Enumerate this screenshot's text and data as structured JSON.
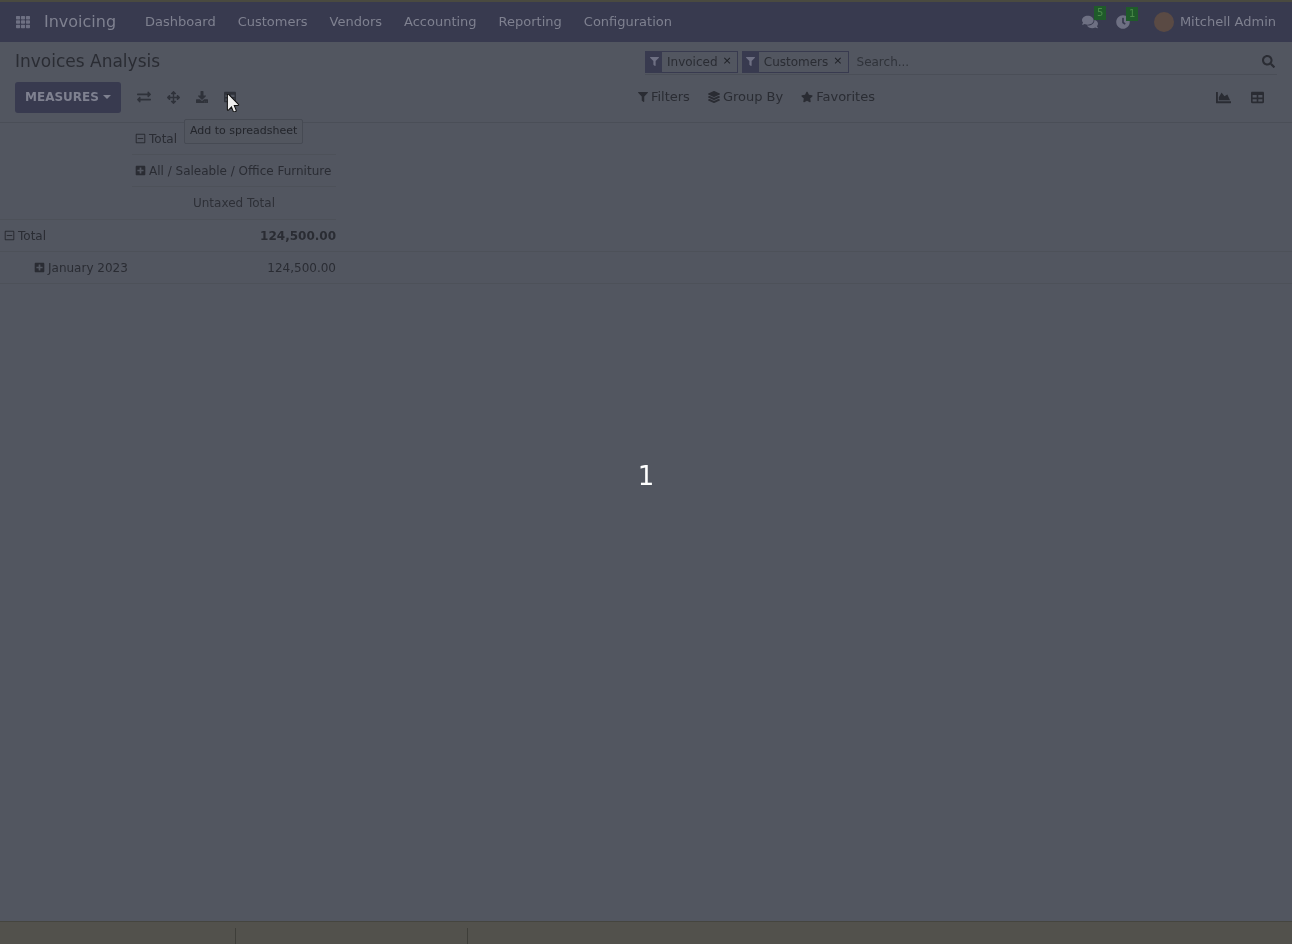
{
  "navbar": {
    "app_name": "Invoicing",
    "menu": [
      "Dashboard",
      "Customers",
      "Vendors",
      "Accounting",
      "Reporting",
      "Configuration"
    ],
    "messages_badge": "5",
    "activities_badge": "1",
    "user": "Mitchell Admin"
  },
  "breadcrumb": "Invoices Analysis",
  "search": {
    "facets": [
      {
        "label": "Invoiced",
        "remove": "×"
      },
      {
        "label": "Customers",
        "remove": "×"
      }
    ],
    "placeholder": "Search..."
  },
  "measures_button": "MEASURES",
  "search_menus": [
    {
      "kind": "filter",
      "label": "Filters"
    },
    {
      "kind": "group",
      "label": "Group By"
    },
    {
      "kind": "favorite",
      "label": "Favorites"
    }
  ],
  "views": [
    {
      "kind": "graph"
    },
    {
      "kind": "pivot"
    }
  ],
  "tooltip": "Add to spreadsheet",
  "pivot": {
    "col_headers": [
      {
        "label": "Total",
        "expanded": true
      },
      {
        "label": "All / Saleable / Office Furniture",
        "expanded": false
      }
    ],
    "measure": "Untaxed Total",
    "rows": [
      {
        "label": "Total",
        "expanded": true,
        "value": "124,500.00",
        "children": [
          {
            "label": "January 2023",
            "expanded": false,
            "value": "124,500.00"
          }
        ]
      }
    ]
  },
  "overlay_text": "1"
}
